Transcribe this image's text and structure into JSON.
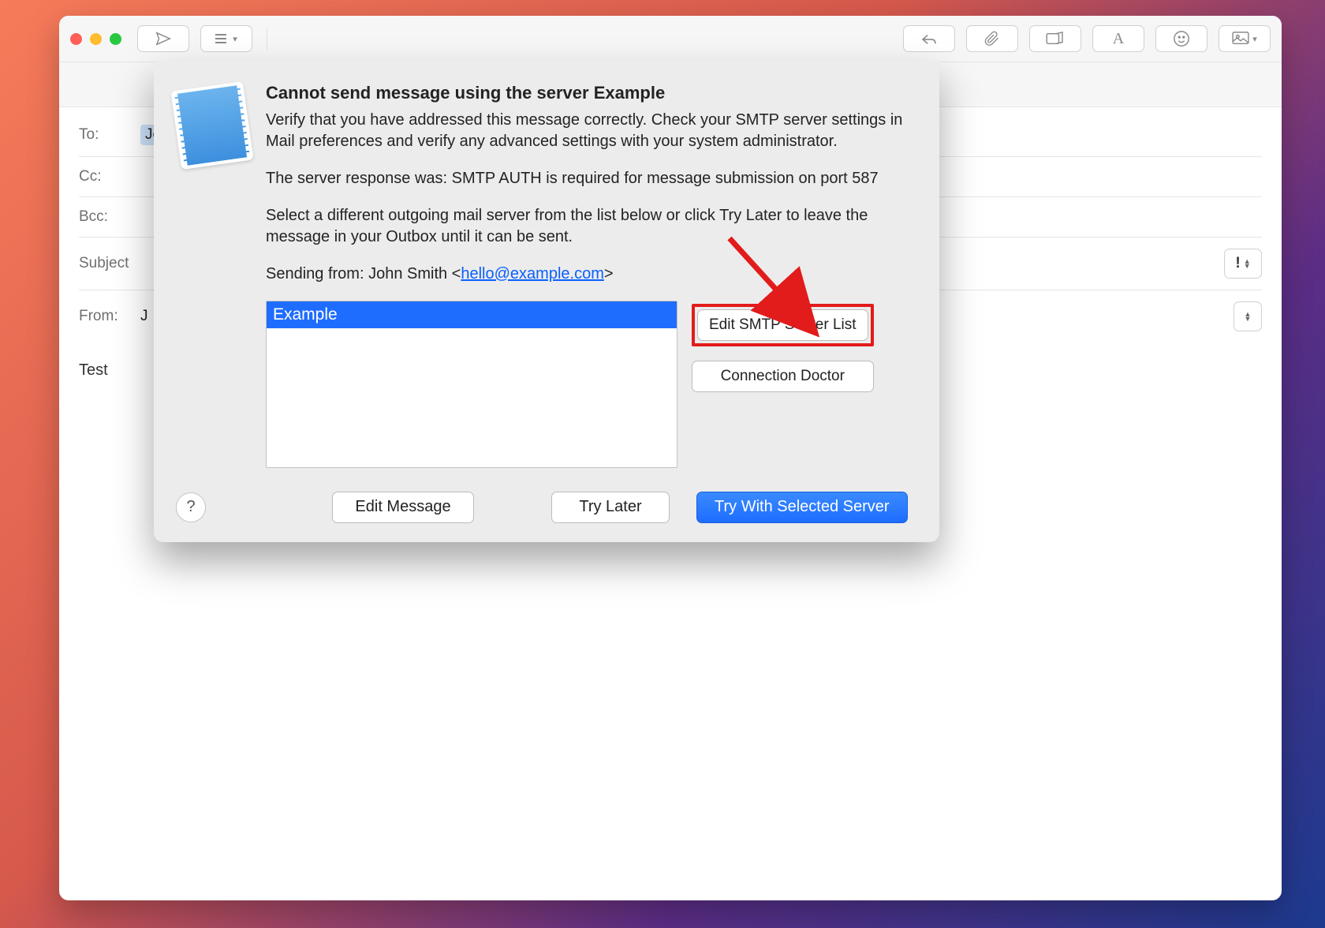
{
  "toolbar": {
    "font_name": "Helvetica",
    "font_size": "12"
  },
  "compose": {
    "to_label": "To:",
    "to_value": "Jef",
    "cc_label": "Cc:",
    "bcc_label": "Bcc:",
    "subject_label": "Subject",
    "from_label": "From:",
    "from_value": "J",
    "priority_mark": "!",
    "body": "Test"
  },
  "dialog": {
    "title": "Cannot send message using the server Example",
    "p1": "Verify that you have addressed this message correctly. Check your SMTP server settings in Mail preferences and verify any advanced settings with your system administrator.",
    "p2": "The server response was: SMTP AUTH is required for message submission on port 587",
    "p3": "Select a different outgoing mail server from the list below or click Try Later to leave the message in your Outbox until it can be sent.",
    "sending_prefix": "Sending from: John Smith <",
    "sending_email": "hello@example.com",
    "sending_suffix": ">",
    "server_selected": "Example",
    "edit_smtp": "Edit SMTP Server List",
    "conn_doctor": "Connection Doctor",
    "help": "?",
    "edit_message": "Edit Message",
    "try_later": "Try Later",
    "try_selected": "Try With Selected Server"
  }
}
